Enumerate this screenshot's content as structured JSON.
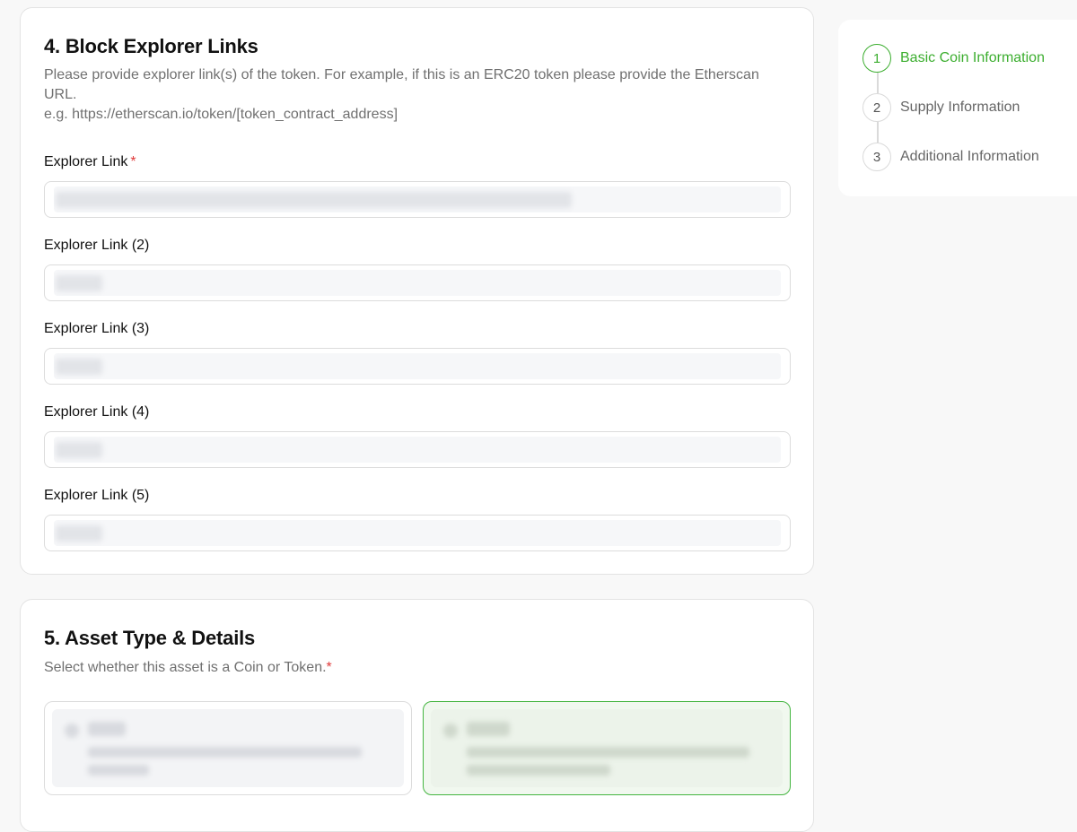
{
  "section4": {
    "title": "4. Block Explorer Links",
    "description_line1": "Please provide explorer link(s) of the token. For example, if this is an ERC20 token please provide the Etherscan URL.",
    "description_line2": "e.g. https://etherscan.io/token/[token_contract_address]",
    "fields": [
      {
        "label": "Explorer Link",
        "required_mark": "*"
      },
      {
        "label": "Explorer Link (2)"
      },
      {
        "label": "Explorer Link (3)"
      },
      {
        "label": "Explorer Link (4)"
      },
      {
        "label": "Explorer Link (5)"
      }
    ]
  },
  "section5": {
    "title": "5. Asset Type & Details",
    "description": "Select whether this asset is a Coin or Token.",
    "required_mark": "*"
  },
  "steps": [
    {
      "number": "1",
      "label": "Basic Coin Information",
      "active": true
    },
    {
      "number": "2",
      "label": "Supply Information",
      "active": false
    },
    {
      "number": "3",
      "label": "Additional Information",
      "active": false
    }
  ],
  "colors": {
    "accent": "#3cae2f",
    "required": "#e03a3a",
    "selected_border": "#44b540"
  }
}
